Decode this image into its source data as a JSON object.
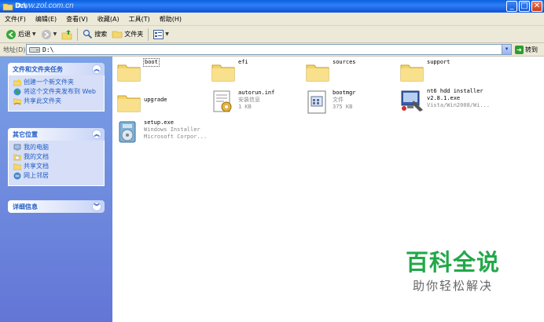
{
  "window": {
    "title": "D:\\",
    "watermark": "www.zol.com.cn",
    "minimize": "_",
    "maximize": "□",
    "close": "✕"
  },
  "menu": [
    "文件(F)",
    "编辑(E)",
    "查看(V)",
    "收藏(A)",
    "工具(T)",
    "帮助(H)"
  ],
  "toolbar": {
    "back_label": "后退",
    "search_label": "搜索",
    "folders_label": "文件夹"
  },
  "address": {
    "label": "地址(D)",
    "value": "D:\\",
    "go_label": "转到"
  },
  "tasks_panel": {
    "title": "文件和文件夹任务",
    "items": [
      {
        "label": "创建一个新文件夹",
        "icon": "new-folder-icon"
      },
      {
        "label": "将这个文件夹发布到 Web",
        "icon": "publish-web-icon"
      },
      {
        "label": "共享此文件夹",
        "icon": "share-folder-icon"
      }
    ]
  },
  "places_panel": {
    "title": "其它位置",
    "items": [
      {
        "label": "我的电脑",
        "icon": "my-computer-icon"
      },
      {
        "label": "我的文档",
        "icon": "my-documents-icon"
      },
      {
        "label": "共享文档",
        "icon": "shared-documents-icon"
      },
      {
        "label": "网上邻居",
        "icon": "network-places-icon"
      }
    ]
  },
  "details_panel": {
    "title": "详细信息"
  },
  "files": [
    {
      "name": "boot",
      "type": "folder",
      "desc1": "",
      "desc2": "",
      "selected": true
    },
    {
      "name": "efi",
      "type": "folder",
      "desc1": "",
      "desc2": ""
    },
    {
      "name": "sources",
      "type": "folder",
      "desc1": "",
      "desc2": ""
    },
    {
      "name": "support",
      "type": "folder",
      "desc1": "",
      "desc2": ""
    },
    {
      "name": "upgrade",
      "type": "folder",
      "desc1": "",
      "desc2": ""
    },
    {
      "name": "autorun.inf",
      "type": "inf",
      "desc1": "安装信息",
      "desc2": "1 KB"
    },
    {
      "name": "bootmgr",
      "type": "file",
      "desc1": "文件",
      "desc2": "375 KB"
    },
    {
      "name": "nt6 hdd installer v2.8.1.exe",
      "type": "exe",
      "desc1": "Vista/Win2008/Wi...",
      "desc2": ""
    },
    {
      "name": "setup.exe",
      "type": "setup",
      "desc1": "Windows Installer",
      "desc2": "Microsoft Corpor..."
    }
  ],
  "brand": {
    "main": "百科全说",
    "sub": "助你轻松解决"
  },
  "colors": {
    "titlebar": "#0a5fe0",
    "leftpane": "#6d8cdc",
    "brand_green": "#22a849"
  }
}
